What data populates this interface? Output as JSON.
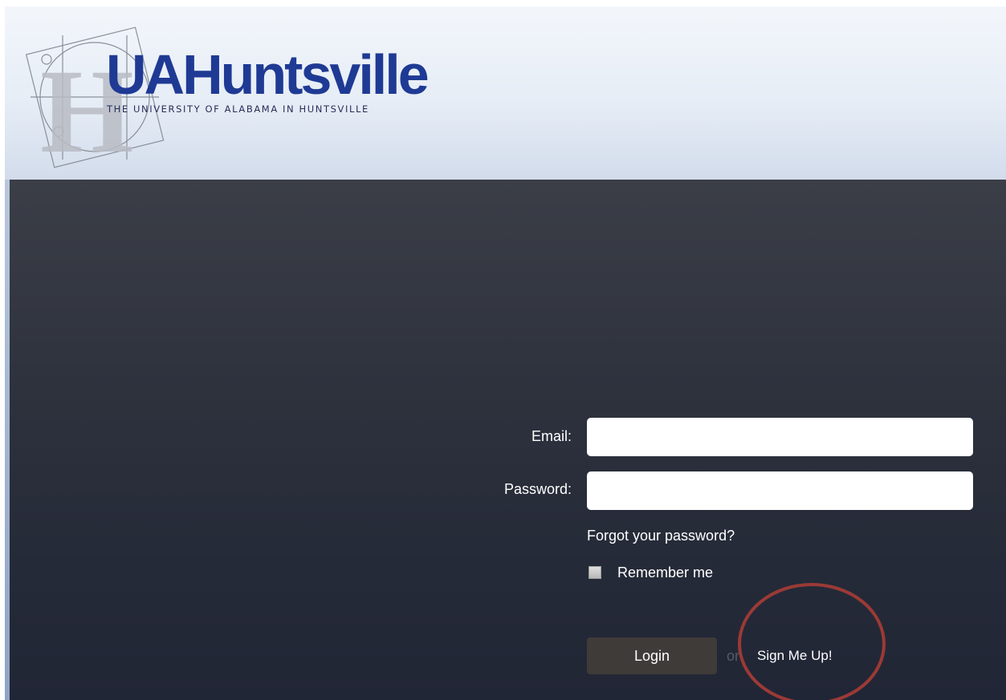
{
  "header": {
    "logo_word": "UAHuntsville",
    "logo_tagline": "THE UNIVERSITY OF ALABAMA IN HUNTSVILLE",
    "brand_color": "#1f3a94"
  },
  "login_form": {
    "email_label": "Email:",
    "email_value": "",
    "password_label": "Password:",
    "password_value": "",
    "forgot_link": "Forgot your password?",
    "remember_label": "Remember me",
    "remember_checked": false,
    "login_button": "Login",
    "or_text": "or",
    "signup_link": "Sign Me Up!"
  },
  "annotation": {
    "highlight_color": "#9b3a35",
    "highlight_icon": "circle-annotation-icon"
  },
  "colors": {
    "panel_top": "#3b3e47",
    "panel_bottom": "#212636",
    "header_bg": "#e6edf6"
  }
}
